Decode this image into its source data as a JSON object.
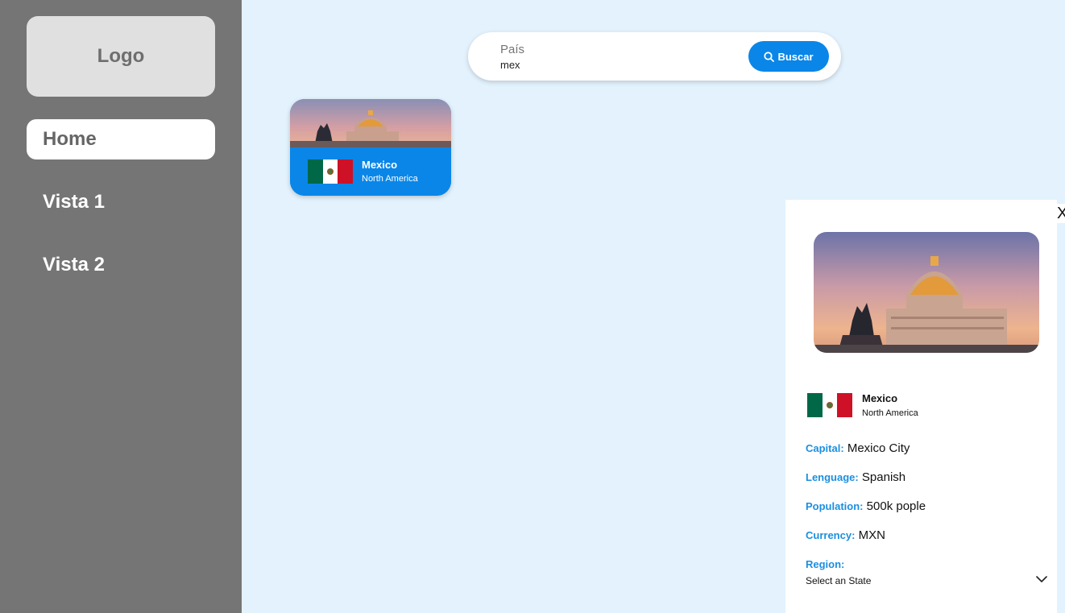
{
  "sidebar": {
    "logo": "Logo",
    "items": [
      {
        "label": "Home",
        "active": true
      },
      {
        "label": "Vista 1",
        "active": false
      },
      {
        "label": "Vista 2",
        "active": false
      }
    ]
  },
  "search": {
    "label": "País",
    "value": "mex",
    "button_label": "Buscar",
    "button_icon": "search-icon"
  },
  "card": {
    "name": "Mexico",
    "region": "North America"
  },
  "detail": {
    "close_label": "X",
    "name": "Mexico",
    "region": "North America",
    "capital_label": "Capital:",
    "capital": "Mexico City",
    "language_label": "Lenguage:",
    "language": "Spanish",
    "population_label": "Population:",
    "population": "500k pople",
    "currency_label": "Currency:",
    "currency": "MXN",
    "region_label": "Region:",
    "region_select": "Select an State"
  },
  "colors": {
    "accent": "#0a86e8",
    "label_blue": "#1b8fe0",
    "sidebar_bg": "#757575",
    "page_bg": "#e3f2fd"
  }
}
